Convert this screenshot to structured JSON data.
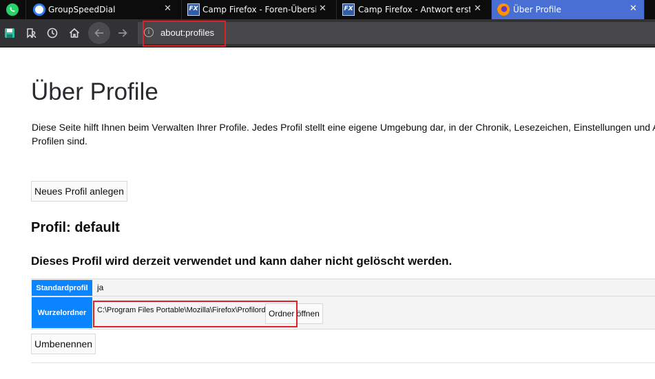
{
  "tabs": [
    {
      "title": "",
      "icon": "whatsapp-icon"
    },
    {
      "title": "GroupSpeedDial",
      "icon": "groupspeeddial-icon",
      "close": "✕"
    },
    {
      "title": "Camp Firefox - Foren-Übersicht",
      "icon": "camp-firefox-icon",
      "close": "✕"
    },
    {
      "title": "Camp Firefox - Antwort erstellen",
      "icon": "camp-firefox-icon",
      "close": "✕"
    },
    {
      "title": "Über Profile",
      "icon": "firefox-icon",
      "close": "✕",
      "active": true
    }
  ],
  "toolbar": {
    "buttons": [
      "save-icon",
      "bookmark-user-icon",
      "history-clock-icon",
      "home-icon",
      "back-arrow-icon",
      "forward-arrow-icon"
    ],
    "url": "about:profiles",
    "info_icon": "i"
  },
  "page": {
    "title": "Über Profile",
    "description": "Diese Seite hilft Ihnen beim Verwalten Ihrer Profile. Jedes Profil stellt eine eigene Umgebung dar, in der Chronik, Lesezeichen, Einstellungen und Add-ons getrennt von anderen Profilen sind.",
    "new_profile_button": "Neues Profil anlegen",
    "profile_heading": "Profil: default",
    "profile_note": "Dieses Profil wird derzeit verwendet und kann daher nicht gelöscht werden.",
    "rows": [
      {
        "key": "Standardprofil",
        "value": "ja"
      },
      {
        "key": "Wurzelordner",
        "value": "C:\\Program Files Portable\\Mozilla\\Firefox\\Profilordner",
        "button": "Ordner öffnen"
      }
    ],
    "rename_button": "Umbenennen"
  },
  "colors": {
    "accent": "#0a84ff",
    "highlight": "#e02026",
    "active_tab": "#4a6fd4"
  }
}
